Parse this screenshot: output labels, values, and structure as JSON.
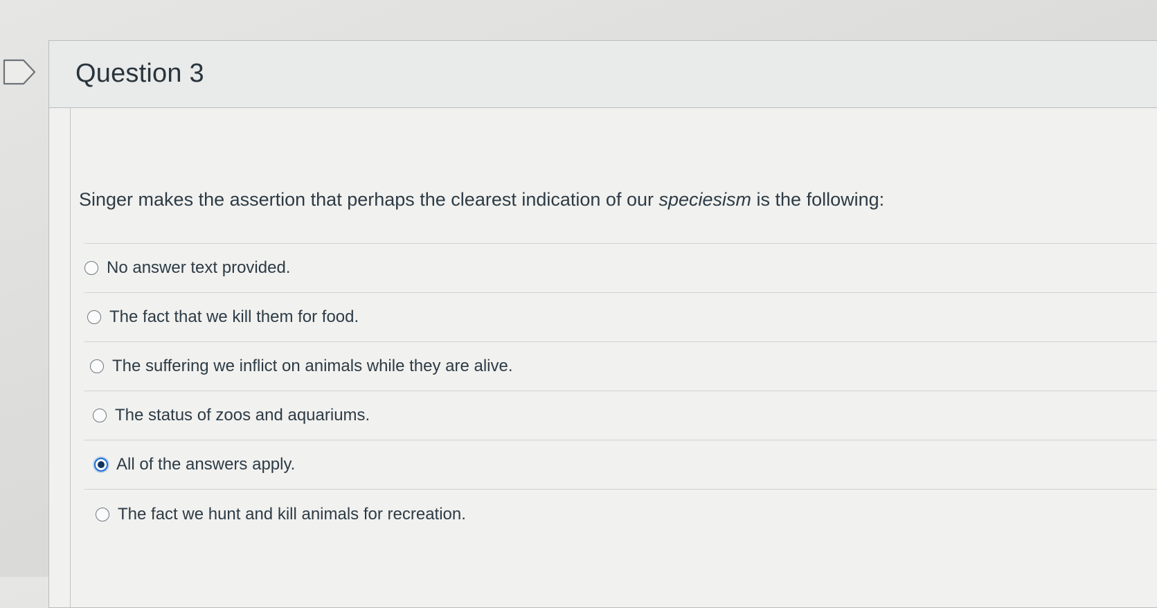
{
  "question": {
    "title": "Question 3",
    "text_before": "Singer makes the assertion that perhaps the clearest indication of our ",
    "text_emphasis": "speciesism",
    "text_after": " is the following:",
    "answers": [
      {
        "label": "No answer text provided.",
        "selected": false
      },
      {
        "label": "The fact that we kill them for food.",
        "selected": false
      },
      {
        "label": "The suffering we inflict on animals while they are alive.",
        "selected": false
      },
      {
        "label": "The status of zoos and aquariums.",
        "selected": false
      },
      {
        "label": "All of the answers apply.",
        "selected": true
      },
      {
        "label": "The fact we hunt and kill animals for recreation.",
        "selected": false
      }
    ]
  },
  "colors": {
    "selected_ring": "#1d6fd6",
    "selected_dot": "#12335e",
    "text": "#2d3b45"
  },
  "icons": {
    "flag": "flag-icon"
  }
}
